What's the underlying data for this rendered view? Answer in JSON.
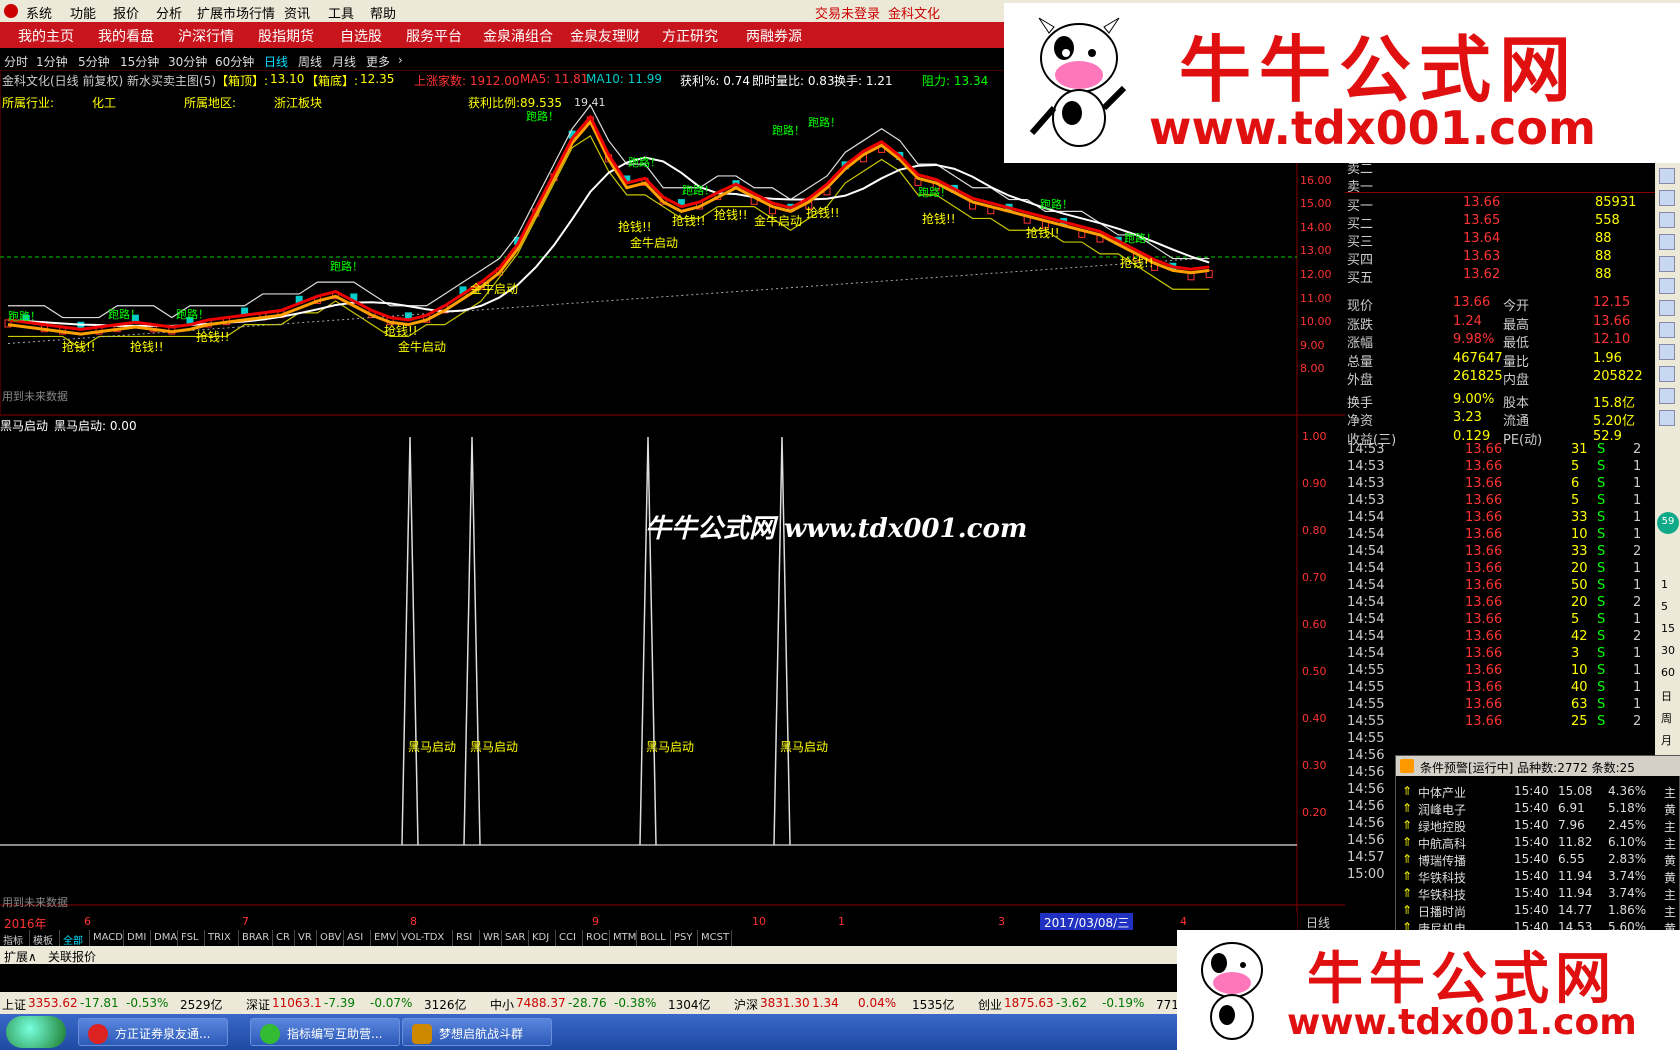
{
  "menu": {
    "items": [
      "系统",
      "功能",
      "报价",
      "分析",
      "扩展市场行情",
      "资讯",
      "工具",
      "帮助"
    ],
    "trade_status": "交易未登录",
    "stock_name": "金科文化"
  },
  "nav": {
    "items": [
      "我的主页",
      "我的看盘",
      "沪深行情",
      "股指期货",
      "自选股",
      "服务平台",
      "金泉涌组合",
      "金泉友理财",
      "方正研究",
      "两融券源"
    ]
  },
  "periods": {
    "items": [
      "分时",
      "1分钟",
      "5分钟",
      "15分钟",
      "30分钟",
      "60分钟",
      "日线",
      "周线",
      "月线",
      "更多"
    ],
    "active": "日线"
  },
  "chart_header": {
    "title": "金科文化(日线 前复权) 新水买卖主图(5)",
    "box_top_label": "【箱顶】:",
    "box_top": "13.10",
    "box_bottom_label": "【箱底】:",
    "box_bottom": "12.35",
    "upper": "上涨家数: 1912.00",
    "ma5": "MA5: 11.81",
    "ma10": "MA10: 11.99",
    "profit": "获利%: 0.74",
    "vol_ratio": "即时量比: 0.83",
    "turnover": "换手: 1.21",
    "resist": "阻力: 13.34",
    "industry_label": "所属行业:",
    "industry": "化工",
    "region_label": "所属地区:",
    "region": "浙江板块",
    "profit_ratio": "获利比例:89.535"
  },
  "main_chart": {
    "yticks": [
      "17.00",
      "16.00",
      "15.00",
      "14.00",
      "13.00",
      "12.00",
      "11.00",
      "10.00",
      "9.00",
      "8.00"
    ],
    "high_label": "19.41",
    "future_note": "用到未来数据",
    "signals": {
      "run": "跑路！",
      "grab": "抢钱!!",
      "golden": "金牛启动"
    }
  },
  "sub_chart": {
    "title": "黑马启动",
    "value_label": "黑马启动: 0.00",
    "yticks": [
      "1.00",
      "0.90",
      "0.80",
      "0.70",
      "0.60",
      "0.50",
      "0.40",
      "0.30",
      "0.20"
    ],
    "signal_label": "黑马启动",
    "future_note": "用到未来数据"
  },
  "chart_data": {
    "type": "line",
    "series": [
      {
        "name": "黑马启动",
        "x": [
          1,
          2,
          3,
          4
        ],
        "values": [
          1,
          1,
          1,
          1
        ]
      }
    ],
    "ylim": [
      0,
      1
    ]
  },
  "xaxis": {
    "labels": [
      "2016年",
      "6",
      "7",
      "8",
      "9",
      "10",
      "1",
      "3",
      "4"
    ],
    "cursor_date": "2017/03/08/三",
    "period": "日线"
  },
  "quote": {
    "sells": [
      {
        "label": "卖二"
      },
      {
        "label": "卖一"
      }
    ],
    "buys": [
      {
        "label": "买一",
        "price": "13.66",
        "vol": "85931"
      },
      {
        "label": "买二",
        "price": "13.65",
        "vol": "558"
      },
      {
        "label": "买三",
        "price": "13.64",
        "vol": "88"
      },
      {
        "label": "买四",
        "price": "13.63",
        "vol": "88"
      },
      {
        "label": "买五",
        "price": "13.62",
        "vol": "88"
      }
    ],
    "stats": [
      {
        "k1": "现价",
        "v1": "13.66",
        "k2": "今开",
        "v2": "12.15"
      },
      {
        "k1": "涨跌",
        "v1": "1.24",
        "k2": "最高",
        "v2": "13.66"
      },
      {
        "k1": "涨幅",
        "v1": "9.98%",
        "k2": "最低",
        "v2": "12.10"
      },
      {
        "k1": "总量",
        "v1": "467647",
        "k2": "量比",
        "v2": "1.96"
      },
      {
        "k1": "外盘",
        "v1": "261825",
        "k2": "内盘",
        "v2": "205822"
      },
      {
        "k1": "换手",
        "v1": "9.00%",
        "k2": "股本",
        "v2": "15.8亿"
      },
      {
        "k1": "净资",
        "v1": "3.23",
        "k2": "流通",
        "v2": "5.20亿"
      },
      {
        "k1": "收益(三)",
        "v1": "0.129",
        "k2": "PE(动)",
        "v2": "52.9"
      }
    ],
    "ticks": [
      {
        "t": "14:53",
        "p": "13.66",
        "v": "31",
        "s": "S",
        "n": "2"
      },
      {
        "t": "14:53",
        "p": "13.66",
        "v": "5",
        "s": "S",
        "n": "1"
      },
      {
        "t": "14:53",
        "p": "13.66",
        "v": "6",
        "s": "S",
        "n": "1"
      },
      {
        "t": "14:53",
        "p": "13.66",
        "v": "5",
        "s": "S",
        "n": "1"
      },
      {
        "t": "14:54",
        "p": "13.66",
        "v": "33",
        "s": "S",
        "n": "1"
      },
      {
        "t": "14:54",
        "p": "13.66",
        "v": "10",
        "s": "S",
        "n": "1"
      },
      {
        "t": "14:54",
        "p": "13.66",
        "v": "33",
        "s": "S",
        "n": "2"
      },
      {
        "t": "14:54",
        "p": "13.66",
        "v": "20",
        "s": "S",
        "n": "1"
      },
      {
        "t": "14:54",
        "p": "13.66",
        "v": "50",
        "s": "S",
        "n": "1"
      },
      {
        "t": "14:54",
        "p": "13.66",
        "v": "20",
        "s": "S",
        "n": "2"
      },
      {
        "t": "14:54",
        "p": "13.66",
        "v": "5",
        "s": "S",
        "n": "1"
      },
      {
        "t": "14:54",
        "p": "13.66",
        "v": "42",
        "s": "S",
        "n": "2"
      },
      {
        "t": "14:54",
        "p": "13.66",
        "v": "3",
        "s": "S",
        "n": "1"
      },
      {
        "t": "14:55",
        "p": "13.66",
        "v": "10",
        "s": "S",
        "n": "1"
      },
      {
        "t": "14:55",
        "p": "13.66",
        "v": "40",
        "s": "S",
        "n": "1"
      },
      {
        "t": "14:55",
        "p": "13.66",
        "v": "63",
        "s": "S",
        "n": "1"
      },
      {
        "t": "14:55",
        "p": "13.66",
        "v": "25",
        "s": "S",
        "n": "2"
      }
    ],
    "time_only": [
      "14:55",
      "14:56",
      "14:56",
      "14:56",
      "14:56",
      "14:56",
      "14:56",
      "14:57",
      "15:00"
    ]
  },
  "alerts": {
    "title": "条件预警[运行中] 品种数:2772 条数:25",
    "rows": [
      {
        "name": "中体产业",
        "time": "15:40",
        "price": "15.08",
        "pct": "4.36%",
        "tag": "主"
      },
      {
        "name": "润峰电子",
        "time": "15:40",
        "price": "6.91",
        "pct": "5.18%",
        "tag": "黄"
      },
      {
        "name": "绿地控股",
        "time": "15:40",
        "price": "7.96",
        "pct": "2.45%",
        "tag": "主"
      },
      {
        "name": "中航高科",
        "time": "15:40",
        "price": "11.82",
        "pct": "6.10%",
        "tag": "主"
      },
      {
        "name": "博瑞传播",
        "time": "15:40",
        "price": "6.55",
        "pct": "2.83%",
        "tag": "黄"
      },
      {
        "name": "华铁科技",
        "time": "15:40",
        "price": "11.94",
        "pct": "3.74%",
        "tag": "黄"
      },
      {
        "name": "华铁科技",
        "time": "15:40",
        "price": "11.94",
        "pct": "3.74%",
        "tag": "主"
      },
      {
        "name": "日播时尚",
        "time": "15:40",
        "price": "14.77",
        "pct": "1.86%",
        "tag": "主"
      },
      {
        "name": "康尼机电",
        "time": "15:40",
        "price": "14.53",
        "pct": "5.60%",
        "tag": "黄"
      }
    ]
  },
  "indicator_tabs": [
    "指标",
    "模板",
    "全部",
    "MACD",
    "DMI",
    "DMA",
    "FSL",
    "TRIX",
    "BRAR",
    "CR",
    "VR",
    "OBV",
    "ASI",
    "EMV",
    "VOL-TDX",
    "RSI",
    "WR",
    "SAR",
    "KDJ",
    "CCI",
    "ROC",
    "MTM",
    "BOLL",
    "PSY",
    "MCST"
  ],
  "ext_bar": {
    "ext": "扩展∧",
    "quote": "关联报价"
  },
  "indices": [
    {
      "name": "上证",
      "val": "3353.62",
      "chg": "-17.81",
      "pct": "-0.53%",
      "amt": "2529亿"
    },
    {
      "name": "深证",
      "val": "11063.1",
      "chg": "-7.39",
      "pct": "-0.07%",
      "amt": "3126亿"
    },
    {
      "name": "中小",
      "val": "7488.37",
      "chg": "-28.76",
      "pct": "-0.38%",
      "amt": "1304亿"
    },
    {
      "name": "沪深",
      "val": "3831.30",
      "chg": "1.34",
      "pct": "0.04%",
      "amt": "1535亿"
    },
    {
      "name": "创业",
      "val": "1875.63",
      "chg": "-3.62",
      "pct": "-0.19%",
      "amt": "771.6亿"
    }
  ],
  "taskbar": [
    "方正证券泉友通...",
    "指标编写互助营...",
    "梦想启航战斗群"
  ],
  "watermark": {
    "title": "牛牛公式网",
    "url": "www.tdx001.com",
    "center": "牛牛公式网 www.tdx001.com"
  },
  "side_numbers": [
    "1",
    "5",
    "15",
    "30",
    "60",
    "日",
    "周",
    "月"
  ],
  "badge": "59"
}
